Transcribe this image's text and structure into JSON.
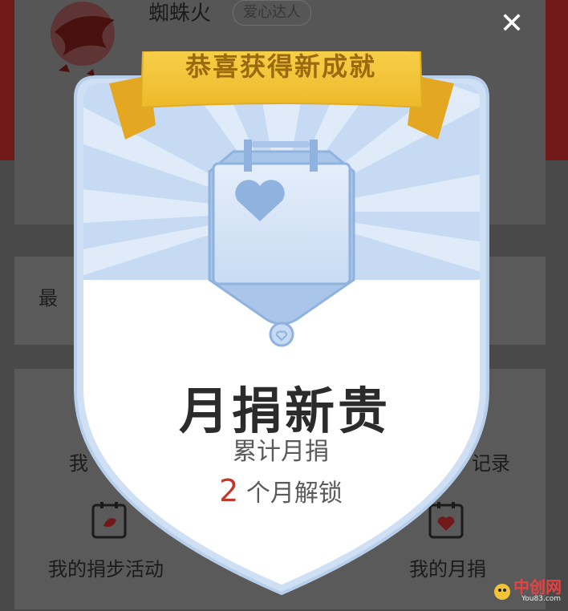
{
  "profile": {
    "username": "蜘蛛火",
    "badge": "爱心达人"
  },
  "background": {
    "latest_label_partial": "最",
    "menu_item_left_partial": "我",
    "menu_item_right_partial": "记录",
    "step_activity_label": "我的捐步活动",
    "monthly_donation_label": "我的月捐"
  },
  "modal": {
    "ribbon_text": "恭喜获得新成就",
    "achievement_title": "月捐新贵",
    "achievement_subtitle": "累计月捐",
    "unlock_count": "2",
    "unlock_suffix": " 个月解锁",
    "close_icon": "close-icon"
  },
  "watermark": {
    "text": "中创网",
    "sub": "You83.com"
  },
  "colors": {
    "header_red": "#8a1f1f",
    "ribbon_gold": "#f2c437",
    "shield_blue": "#c9dcf3",
    "highlight_red": "#c0392b"
  }
}
